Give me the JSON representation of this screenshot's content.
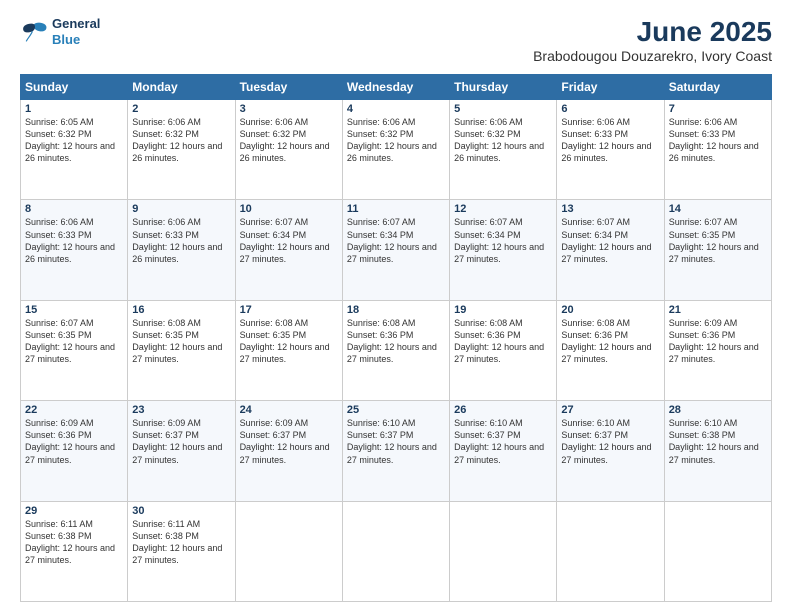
{
  "header": {
    "logo": {
      "line1": "General",
      "line2": "Blue"
    },
    "title": "June 2025",
    "subtitle": "Brabodougou Douzarekro, Ivory Coast"
  },
  "calendar": {
    "days_of_week": [
      "Sunday",
      "Monday",
      "Tuesday",
      "Wednesday",
      "Thursday",
      "Friday",
      "Saturday"
    ],
    "weeks": [
      [
        null,
        null,
        null,
        null,
        null,
        null,
        null
      ]
    ],
    "cells": [
      {
        "day": null,
        "info": ""
      },
      {
        "day": null,
        "info": ""
      },
      {
        "day": null,
        "info": ""
      },
      {
        "day": null,
        "info": ""
      },
      {
        "day": null,
        "info": ""
      },
      {
        "day": null,
        "info": ""
      },
      {
        "day": null,
        "info": ""
      }
    ],
    "rows": [
      [
        {
          "day": "1",
          "sunrise": "6:05 AM",
          "sunset": "6:32 PM",
          "daylight": "12 hours and 26 minutes."
        },
        {
          "day": "2",
          "sunrise": "6:06 AM",
          "sunset": "6:32 PM",
          "daylight": "12 hours and 26 minutes."
        },
        {
          "day": "3",
          "sunrise": "6:06 AM",
          "sunset": "6:32 PM",
          "daylight": "12 hours and 26 minutes."
        },
        {
          "day": "4",
          "sunrise": "6:06 AM",
          "sunset": "6:32 PM",
          "daylight": "12 hours and 26 minutes."
        },
        {
          "day": "5",
          "sunrise": "6:06 AM",
          "sunset": "6:32 PM",
          "daylight": "12 hours and 26 minutes."
        },
        {
          "day": "6",
          "sunrise": "6:06 AM",
          "sunset": "6:33 PM",
          "daylight": "12 hours and 26 minutes."
        },
        {
          "day": "7",
          "sunrise": "6:06 AM",
          "sunset": "6:33 PM",
          "daylight": "12 hours and 26 minutes."
        }
      ],
      [
        {
          "day": "8",
          "sunrise": "6:06 AM",
          "sunset": "6:33 PM",
          "daylight": "12 hours and 26 minutes."
        },
        {
          "day": "9",
          "sunrise": "6:06 AM",
          "sunset": "6:33 PM",
          "daylight": "12 hours and 26 minutes."
        },
        {
          "day": "10",
          "sunrise": "6:07 AM",
          "sunset": "6:34 PM",
          "daylight": "12 hours and 27 minutes."
        },
        {
          "day": "11",
          "sunrise": "6:07 AM",
          "sunset": "6:34 PM",
          "daylight": "12 hours and 27 minutes."
        },
        {
          "day": "12",
          "sunrise": "6:07 AM",
          "sunset": "6:34 PM",
          "daylight": "12 hours and 27 minutes."
        },
        {
          "day": "13",
          "sunrise": "6:07 AM",
          "sunset": "6:34 PM",
          "daylight": "12 hours and 27 minutes."
        },
        {
          "day": "14",
          "sunrise": "6:07 AM",
          "sunset": "6:35 PM",
          "daylight": "12 hours and 27 minutes."
        }
      ],
      [
        {
          "day": "15",
          "sunrise": "6:07 AM",
          "sunset": "6:35 PM",
          "daylight": "12 hours and 27 minutes."
        },
        {
          "day": "16",
          "sunrise": "6:08 AM",
          "sunset": "6:35 PM",
          "daylight": "12 hours and 27 minutes."
        },
        {
          "day": "17",
          "sunrise": "6:08 AM",
          "sunset": "6:35 PM",
          "daylight": "12 hours and 27 minutes."
        },
        {
          "day": "18",
          "sunrise": "6:08 AM",
          "sunset": "6:36 PM",
          "daylight": "12 hours and 27 minutes."
        },
        {
          "day": "19",
          "sunrise": "6:08 AM",
          "sunset": "6:36 PM",
          "daylight": "12 hours and 27 minutes."
        },
        {
          "day": "20",
          "sunrise": "6:08 AM",
          "sunset": "6:36 PM",
          "daylight": "12 hours and 27 minutes."
        },
        {
          "day": "21",
          "sunrise": "6:09 AM",
          "sunset": "6:36 PM",
          "daylight": "12 hours and 27 minutes."
        }
      ],
      [
        {
          "day": "22",
          "sunrise": "6:09 AM",
          "sunset": "6:36 PM",
          "daylight": "12 hours and 27 minutes."
        },
        {
          "day": "23",
          "sunrise": "6:09 AM",
          "sunset": "6:37 PM",
          "daylight": "12 hours and 27 minutes."
        },
        {
          "day": "24",
          "sunrise": "6:09 AM",
          "sunset": "6:37 PM",
          "daylight": "12 hours and 27 minutes."
        },
        {
          "day": "25",
          "sunrise": "6:10 AM",
          "sunset": "6:37 PM",
          "daylight": "12 hours and 27 minutes."
        },
        {
          "day": "26",
          "sunrise": "6:10 AM",
          "sunset": "6:37 PM",
          "daylight": "12 hours and 27 minutes."
        },
        {
          "day": "27",
          "sunrise": "6:10 AM",
          "sunset": "6:37 PM",
          "daylight": "12 hours and 27 minutes."
        },
        {
          "day": "28",
          "sunrise": "6:10 AM",
          "sunset": "6:38 PM",
          "daylight": "12 hours and 27 minutes."
        }
      ],
      [
        {
          "day": "29",
          "sunrise": "6:11 AM",
          "sunset": "6:38 PM",
          "daylight": "12 hours and 27 minutes."
        },
        {
          "day": "30",
          "sunrise": "6:11 AM",
          "sunset": "6:38 PM",
          "daylight": "12 hours and 27 minutes."
        },
        null,
        null,
        null,
        null,
        null
      ]
    ]
  }
}
